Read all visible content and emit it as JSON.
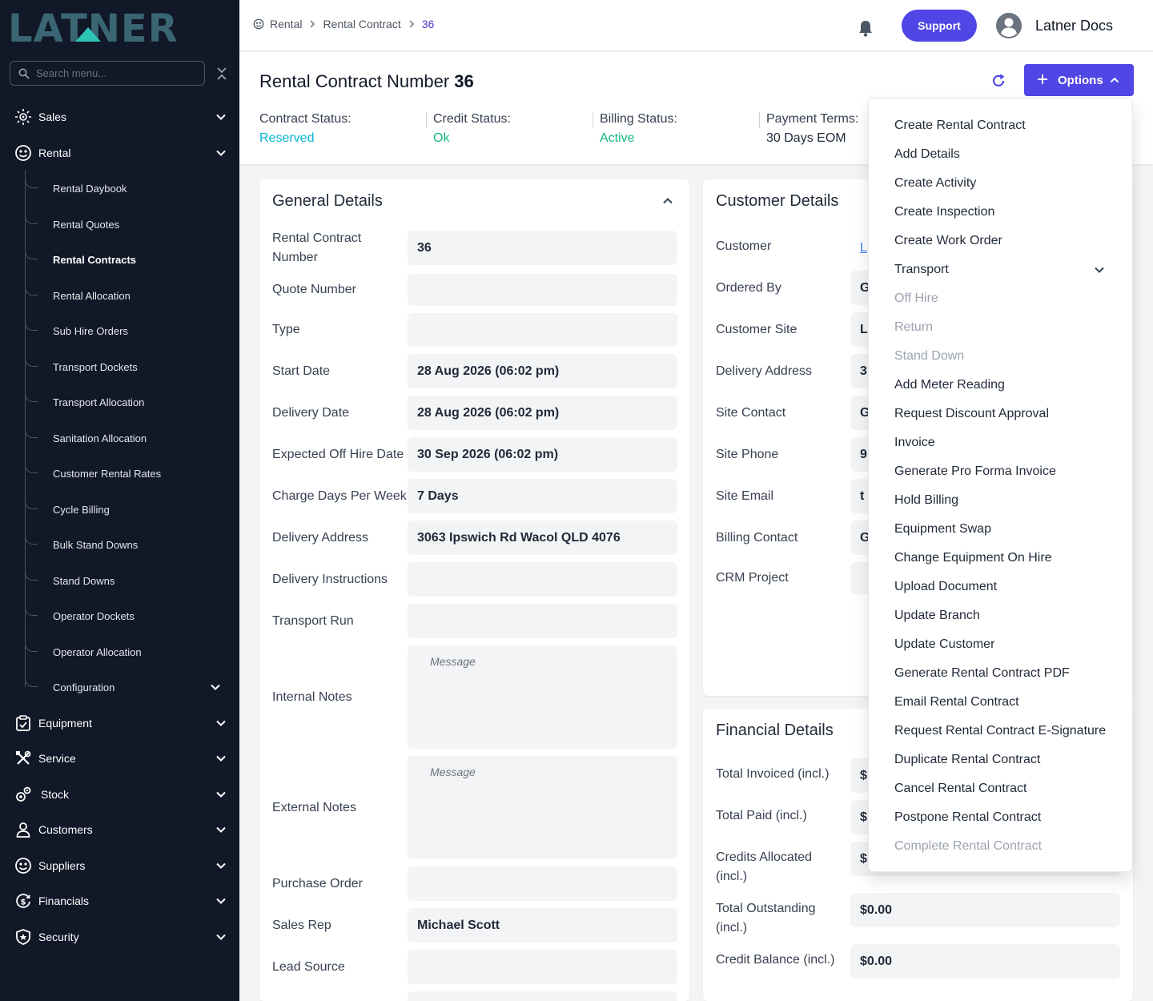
{
  "brand": {
    "logo_text": "LATNER"
  },
  "search": {
    "placeholder": "Search menu..."
  },
  "sidebar": {
    "sections": [
      {
        "label": "Sales",
        "icon": "sales-icon"
      },
      {
        "label": "Rental",
        "icon": "rental-icon"
      },
      {
        "label": "Equipment",
        "icon": "equipment-icon"
      },
      {
        "label": "Service",
        "icon": "service-icon"
      },
      {
        "label": "Stock",
        "icon": "stock-icon"
      },
      {
        "label": "Customers",
        "icon": "customers-icon"
      },
      {
        "label": "Suppliers",
        "icon": "suppliers-icon"
      },
      {
        "label": "Financials",
        "icon": "financials-icon"
      },
      {
        "label": "Security",
        "icon": "security-icon"
      }
    ],
    "rental_items": [
      {
        "label": "Rental Daybook"
      },
      {
        "label": "Rental Quotes"
      },
      {
        "label": "Rental Contracts",
        "active": true
      },
      {
        "label": "Rental Allocation"
      },
      {
        "label": "Sub Hire Orders"
      },
      {
        "label": "Transport Dockets"
      },
      {
        "label": "Transport Allocation"
      },
      {
        "label": "Sanitation Allocation"
      },
      {
        "label": "Customer Rental Rates"
      },
      {
        "label": "Cycle Billing"
      },
      {
        "label": "Bulk Stand Downs"
      },
      {
        "label": "Stand Downs"
      },
      {
        "label": "Operator Dockets"
      },
      {
        "label": "Operator Allocation"
      },
      {
        "label": "Configuration"
      }
    ]
  },
  "topbar": {
    "breadcrumb": [
      "Rental",
      "Rental Contract",
      "36"
    ],
    "support_label": "Support",
    "user_name": "Latner Docs"
  },
  "header": {
    "title": "Rental Contract Number",
    "number": "36",
    "options_label": "Options",
    "statuses": [
      {
        "label": "Contract Status:",
        "value": "Reserved",
        "color": "#06b6d4"
      },
      {
        "label": "Credit Status:",
        "value": "Ok",
        "color": "#10b981"
      },
      {
        "label": "Billing Status:",
        "value": "Active",
        "color": "#10b981"
      },
      {
        "label": "Payment Terms:",
        "value": "30 Days EOM",
        "color": "#1f2937"
      }
    ]
  },
  "general": {
    "title": "General Details",
    "rows": [
      {
        "label": "Rental Contract Number",
        "value": "36"
      },
      {
        "label": "Quote Number",
        "value": ""
      },
      {
        "label": "Type",
        "value": ""
      },
      {
        "label": "Start Date",
        "value": "28 Aug 2026 (06:02 pm)"
      },
      {
        "label": "Delivery Date",
        "value": "28 Aug 2026 (06:02 pm)"
      },
      {
        "label": "Expected Off Hire Date",
        "value": "30 Sep 2026 (06:02 pm)"
      },
      {
        "label": "Charge Days Per Week",
        "value": "7 Days"
      },
      {
        "label": "Delivery Address",
        "value": "3063 Ipswich Rd Wacol QLD 4076"
      },
      {
        "label": "Delivery Instructions",
        "value": ""
      },
      {
        "label": "Transport Run",
        "value": ""
      },
      {
        "label": "Internal Notes",
        "placeholder": "Message"
      },
      {
        "label": "External Notes",
        "placeholder": "Message"
      },
      {
        "label": "Purchase Order",
        "value": ""
      },
      {
        "label": "Sales Rep",
        "value": "Michael Scott"
      },
      {
        "label": "Lead Source",
        "value": ""
      }
    ]
  },
  "customer": {
    "title": "Customer Details",
    "rows": [
      {
        "label": "Customer",
        "value": "L"
      },
      {
        "label": "Ordered By",
        "value": "G"
      },
      {
        "label": "Customer Site",
        "value": "L"
      },
      {
        "label": "Delivery Address",
        "value": "3"
      },
      {
        "label": "Site Contact",
        "value": "G"
      },
      {
        "label": "Site Phone",
        "value": "9"
      },
      {
        "label": "Site Email",
        "value": "t"
      },
      {
        "label": "Billing Contact",
        "value": "G"
      },
      {
        "label": "CRM Project",
        "value": ""
      }
    ]
  },
  "financial": {
    "title": "Financial Details",
    "rows": [
      {
        "label": "Total Invoiced (incl.)",
        "value": "$"
      },
      {
        "label": "Total Paid (incl.)",
        "value": "$"
      },
      {
        "label": "Credits Allocated (incl.)",
        "value": "$"
      },
      {
        "label": "Total Outstanding (incl.)",
        "value": "$0.00"
      },
      {
        "label": "Credit Balance (incl.)",
        "value": "$0.00"
      }
    ]
  },
  "options_menu": [
    {
      "label": "Create Rental Contract",
      "enabled": true
    },
    {
      "label": "Add Details",
      "enabled": true
    },
    {
      "label": "Create Activity",
      "enabled": true
    },
    {
      "label": "Create Inspection",
      "enabled": true
    },
    {
      "label": "Create Work Order",
      "enabled": true
    },
    {
      "label": "Transport",
      "enabled": true,
      "submenu": true
    },
    {
      "label": "Off Hire",
      "enabled": false
    },
    {
      "label": "Return",
      "enabled": false
    },
    {
      "label": "Stand Down",
      "enabled": false
    },
    {
      "label": "Add Meter Reading",
      "enabled": true
    },
    {
      "label": "Request Discount Approval",
      "enabled": true
    },
    {
      "label": "Invoice",
      "enabled": true
    },
    {
      "label": "Generate Pro Forma Invoice",
      "enabled": true
    },
    {
      "label": "Hold Billing",
      "enabled": true
    },
    {
      "label": "Equipment Swap",
      "enabled": true
    },
    {
      "label": "Change Equipment On Hire",
      "enabled": true
    },
    {
      "label": "Upload Document",
      "enabled": true
    },
    {
      "label": "Update Branch",
      "enabled": true
    },
    {
      "label": "Update Customer",
      "enabled": true
    },
    {
      "label": "Generate Rental Contract PDF",
      "enabled": true
    },
    {
      "label": "Email Rental Contract",
      "enabled": true
    },
    {
      "label": "Request Rental Contract E-Signature",
      "enabled": true
    },
    {
      "label": "Duplicate Rental Contract",
      "enabled": true
    },
    {
      "label": "Cancel Rental Contract",
      "enabled": true
    },
    {
      "label": "Postpone Rental Contract",
      "enabled": true
    },
    {
      "label": "Complete Rental Contract",
      "enabled": false
    }
  ]
}
